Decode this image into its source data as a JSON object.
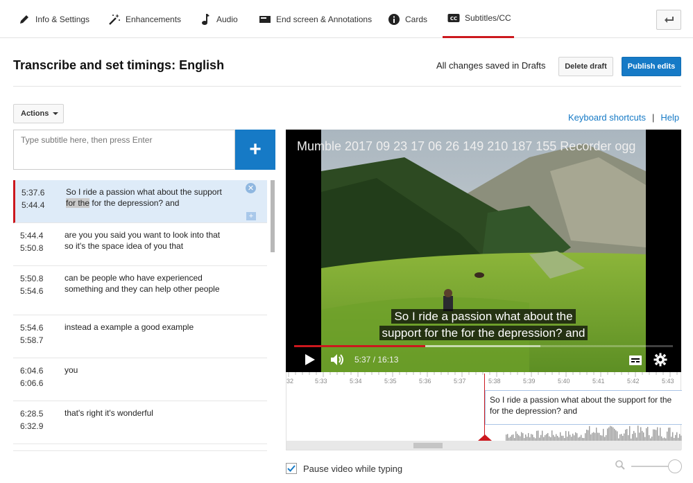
{
  "tabs": [
    {
      "label": "Info & Settings",
      "icon": "pencil-icon"
    },
    {
      "label": "Enhancements",
      "icon": "magic-wand-icon"
    },
    {
      "label": "Audio",
      "icon": "music-note-icon"
    },
    {
      "label": "End screen & Annotations",
      "icon": "end-screen-icon"
    },
    {
      "label": "Cards",
      "icon": "info-icon"
    },
    {
      "label": "Subtitles/CC",
      "icon": "cc-icon",
      "active": true
    }
  ],
  "header": {
    "title": "Transcribe and set timings: English",
    "save_status": "All changes saved in Drafts",
    "delete_draft": "Delete draft",
    "publish": "Publish edits"
  },
  "toolbar": {
    "actions": "Actions",
    "keyboard_shortcuts": "Keyboard shortcuts",
    "separator": "|",
    "help": "Help"
  },
  "editor": {
    "placeholder": "Type subtitle here, then press Enter",
    "add_symbol": "+"
  },
  "captions": [
    {
      "start": "5:37.6",
      "end": "5:44.4",
      "text_before": "So I ride a passion what about the support ",
      "highlight": "for the",
      "text_after": " for the depression? and",
      "selected": true
    },
    {
      "start": "5:44.4",
      "end": "5:50.8",
      "text": "are you you said you want to look into that so it's the space idea of you that"
    },
    {
      "start": "5:50.8",
      "end": "5:54.6",
      "text": "can be people who have experienced something and they can help other people"
    },
    {
      "start": "5:54.6",
      "end": "5:58.7",
      "text": "instead a example a good example"
    },
    {
      "start": "6:04.6",
      "end": "6:06.6",
      "text": "you"
    },
    {
      "start": "6:28.5",
      "end": "6:32.9",
      "text": "that's right it's wonderful"
    }
  ],
  "video": {
    "title": "Mumble 2017 09 23 17 06 26 149 210 187 155 Recorder ogg",
    "caption_line1": "So I ride a passion what about the",
    "caption_line2": "support for the for the depression? and",
    "time": "5:37 / 16:13",
    "played_fraction": 0.347,
    "buffered_fraction": 0.65
  },
  "timeline": {
    "ticks": [
      "32",
      "5:33",
      "5:34",
      "5:35",
      "5:36",
      "5:37",
      "5:38",
      "5:39",
      "5:40",
      "5:41",
      "5:42",
      "5:43"
    ],
    "caption_text": "So I ride a passion what about the support for the for the depression? and"
  },
  "footer": {
    "pause_label": "Pause video while typing",
    "pause_checked": true
  },
  "colors": {
    "accent_red": "#cc181e",
    "primary_blue": "#167ac6",
    "selected_row": "#deebf8"
  }
}
